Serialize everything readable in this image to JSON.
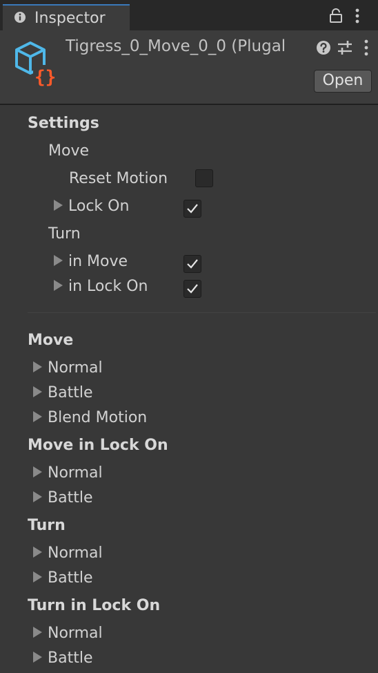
{
  "tab": {
    "label": "Inspector"
  },
  "header": {
    "title": "Tigress_0_Move_0_0 (Plugal",
    "open_label": "Open"
  },
  "settings": {
    "heading": "Settings",
    "move": {
      "label": "Move",
      "reset_motion": {
        "label": "Reset Motion",
        "checked": false
      },
      "lock_on": {
        "label": "Lock On",
        "checked": true
      }
    },
    "turn": {
      "label": "Turn",
      "in_move": {
        "label": "in Move",
        "checked": true
      },
      "in_lock_on": {
        "label": "in Lock On",
        "checked": true
      }
    }
  },
  "sections": [
    {
      "title": "Move",
      "items": [
        "Normal",
        "Battle",
        "Blend Motion"
      ]
    },
    {
      "title": "Move in Lock On",
      "items": [
        "Normal",
        "Battle"
      ]
    },
    {
      "title": "Turn",
      "items": [
        "Normal",
        "Battle"
      ]
    },
    {
      "title": "Turn in Lock On",
      "items": [
        "Normal",
        "Battle"
      ]
    }
  ]
}
